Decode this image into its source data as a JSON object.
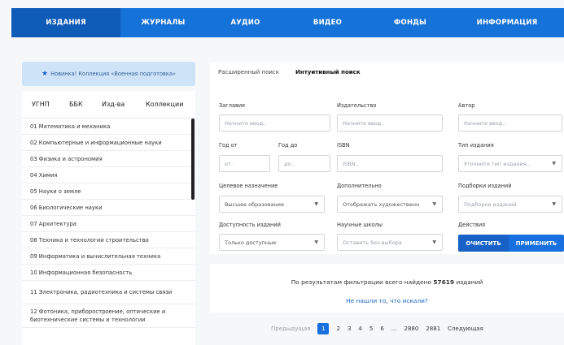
{
  "nav": {
    "items": [
      "ИЗДАНИЯ",
      "ЖУРНАЛЫ",
      "АУДИО",
      "ВИДЕО",
      "ФОНДЫ",
      "ИНФОРМАЦИЯ"
    ]
  },
  "announcement": "Новинка! Коллекция «Военная подготовка»",
  "left_tabs": [
    "УГНП",
    "ББК",
    "Изд-ва",
    "Коллекции"
  ],
  "categories": [
    "01 Математика и механика",
    "02 Компьютерные и информационные науки",
    "03 Физика и астрономия",
    "04 Химия",
    "05 Науки о земле",
    "06 Биологические науки",
    "07 Архитектура",
    "08 Техника и технологии строительства",
    "09 Информатика и вычислительная техника",
    "10 Информационная безопасность",
    "11 Электроника, радиотехника и системы связи",
    "12 Фотоника, приборостроение, оптические и биотехнические системы и технологии"
  ],
  "search_tabs": [
    "Расширенный поиск",
    "Интуитивный поиск"
  ],
  "fields": {
    "title": {
      "label": "Заглавие",
      "placeholder": "Начните ввод.."
    },
    "publisher": {
      "label": "Издательство",
      "placeholder": "Начните ввод.."
    },
    "author": {
      "label": "Автор",
      "placeholder": "Начните ввод.."
    },
    "year_from": {
      "label": "Год от",
      "placeholder": "от.."
    },
    "year_to": {
      "label": "Год до",
      "placeholder": "до.."
    },
    "isbn": {
      "label": "ISBN",
      "placeholder": "ISBN.."
    },
    "edition_type": {
      "label": "Тип издания",
      "placeholder": "Уточните тип издания..."
    },
    "purpose": {
      "label": "Целевое назначение",
      "value": "Высшее образование"
    },
    "additional": {
      "label": "Дополнительно",
      "value": "Отображать художественн"
    },
    "collections": {
      "label": "Подборки изданий",
      "placeholder": "Подборки изданий"
    },
    "availability": {
      "label": "Доступность изданий",
      "value": "Только доступные"
    },
    "schools": {
      "label": "Научные школы",
      "placeholder": "Оставить без выбора"
    },
    "actions": {
      "label": "Действия"
    }
  },
  "buttons": {
    "clear": "ОЧИСТИТЬ",
    "apply": "ПРИМЕНИТЬ"
  },
  "results": {
    "prefix": "По результатам фильтрации всего найдено",
    "count": "57619",
    "suffix": "изданий",
    "not_found": "Не нашли то, что искали?"
  },
  "pagination": {
    "prev": "Предыдущая",
    "pages": [
      "1",
      "2",
      "3",
      "4",
      "5",
      "6",
      "...",
      "2880",
      "2881"
    ],
    "current": "1",
    "next": "Следующая"
  },
  "colors": {
    "accent": "#1770dd",
    "nav": "#1572d8",
    "announce_bg": "#cfe3f8"
  }
}
